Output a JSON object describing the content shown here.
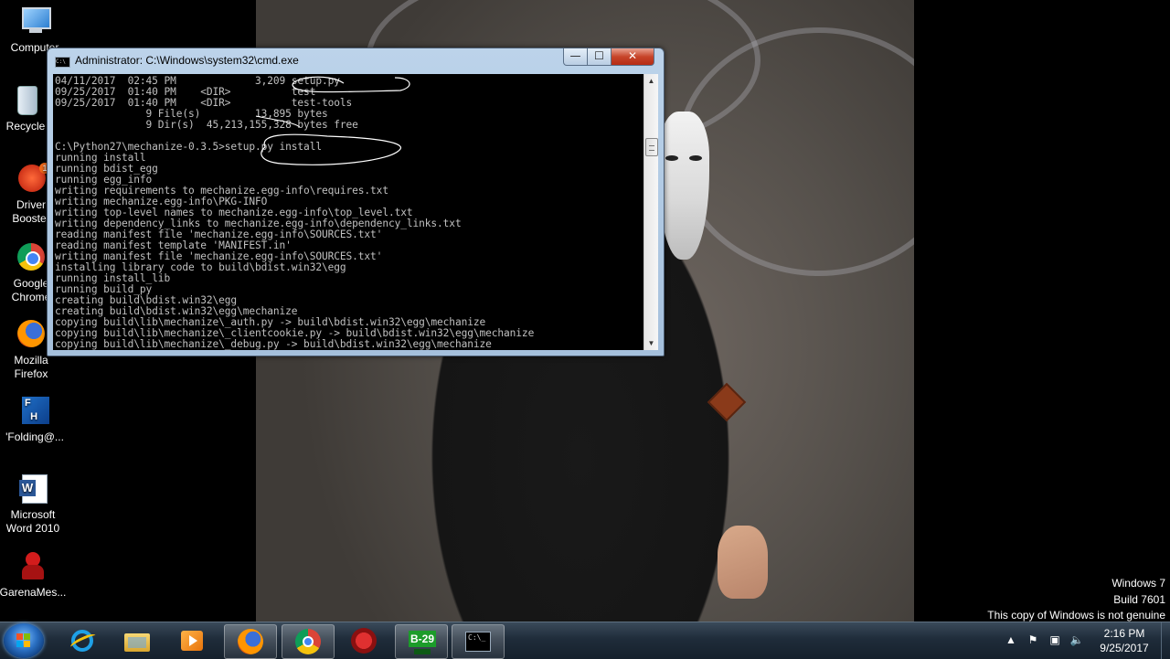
{
  "desktop": {
    "icons": [
      {
        "label": "Computer",
        "icon": "computer-icon"
      },
      {
        "label": "Recycle",
        "icon": "recycle-bin-icon"
      },
      {
        "label": "Driver Booster",
        "icon": "driver-booster-icon",
        "badge": "1"
      },
      {
        "label": "Google Chrome",
        "icon": "chrome-icon"
      },
      {
        "label": "Mozilla Firefox",
        "icon": "firefox-icon"
      },
      {
        "label": "'Folding@...",
        "icon": "folding-at-home-icon"
      },
      {
        "label": "Microsoft Word 2010",
        "icon": "word-icon"
      },
      {
        "label": "GarenaMes...",
        "icon": "garena-messenger-icon"
      }
    ]
  },
  "cmd": {
    "title": "Administrator: C:\\Windows\\system32\\cmd.exe",
    "buttons": {
      "minimize": "—",
      "maximize": "☐",
      "close": "✕"
    },
    "lines": [
      "04/11/2017  02:45 PM             3,209 setup.py",
      "09/25/2017  01:40 PM    <DIR>          test",
      "09/25/2017  01:40 PM    <DIR>          test-tools",
      "               9 File(s)         13,895 bytes",
      "               9 Dir(s)  45,213,155,328 bytes free",
      "",
      "C:\\Python27\\mechanize-0.3.5>setup.py install",
      "running install",
      "running bdist_egg",
      "running egg_info",
      "writing requirements to mechanize.egg-info\\requires.txt",
      "writing mechanize.egg-info\\PKG-INFO",
      "writing top-level names to mechanize.egg-info\\top_level.txt",
      "writing dependency_links to mechanize.egg-info\\dependency_links.txt",
      "reading manifest file 'mechanize.egg-info\\SOURCES.txt'",
      "reading manifest template 'MANIFEST.in'",
      "writing manifest file 'mechanize.egg-info\\SOURCES.txt'",
      "installing library code to build\\bdist.win32\\egg",
      "running install_lib",
      "running build_py",
      "creating build\\bdist.win32\\egg",
      "creating build\\bdist.win32\\egg\\mechanize",
      "copying build\\lib\\mechanize\\_auth.py -> build\\bdist.win32\\egg\\mechanize",
      "copying build\\lib\\mechanize\\_clientcookie.py -> build\\bdist.win32\\egg\\mechanize",
      "copying build\\lib\\mechanize\\_debug.py -> build\\bdist.win32\\egg\\mechanize"
    ]
  },
  "watermark": {
    "line1": "Windows 7",
    "line2": "Build 7601",
    "line3": "This copy of Windows is not genuine"
  },
  "taskbar": {
    "pinned": [
      {
        "name": "internet-explorer",
        "icon": "internet-explorer-icon"
      },
      {
        "name": "file-explorer",
        "icon": "folder-icon"
      },
      {
        "name": "media-player",
        "icon": "media-player-icon"
      },
      {
        "name": "firefox",
        "icon": "firefox-icon"
      },
      {
        "name": "chrome",
        "icon": "chrome-icon"
      },
      {
        "name": "garena",
        "icon": "garena-icon"
      },
      {
        "name": "b29",
        "icon": "b29-icon",
        "label": "B-29"
      },
      {
        "name": "cmd",
        "icon": "cmd-icon",
        "label": "C:\\_"
      }
    ],
    "clock": {
      "time": "2:16 PM",
      "date": "9/25/2017"
    }
  },
  "colors": {
    "console_text": "#c0c0c0",
    "console_bg": "#000000",
    "close_button": "#c7442a",
    "taskbar": "#1f2c3a"
  }
}
